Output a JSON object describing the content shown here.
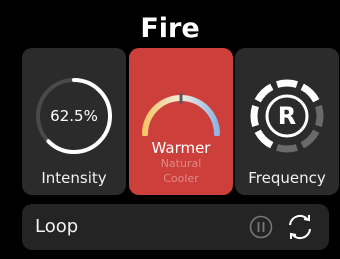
{
  "header": {
    "title": "Fire"
  },
  "intensity": {
    "label": "Intensity",
    "value_text": "62.5%",
    "value": 0.625
  },
  "color_temperature": {
    "selected": "Warmer",
    "options": [
      "Warmer",
      "Natural",
      "Cooler"
    ],
    "card_color": "#cc3f3b"
  },
  "frequency": {
    "label": "Frequency",
    "letter": "R"
  },
  "loop": {
    "label": "Loop",
    "pause_icon": "pause-circle-icon",
    "repeat_icon": "repeat-icon"
  }
}
